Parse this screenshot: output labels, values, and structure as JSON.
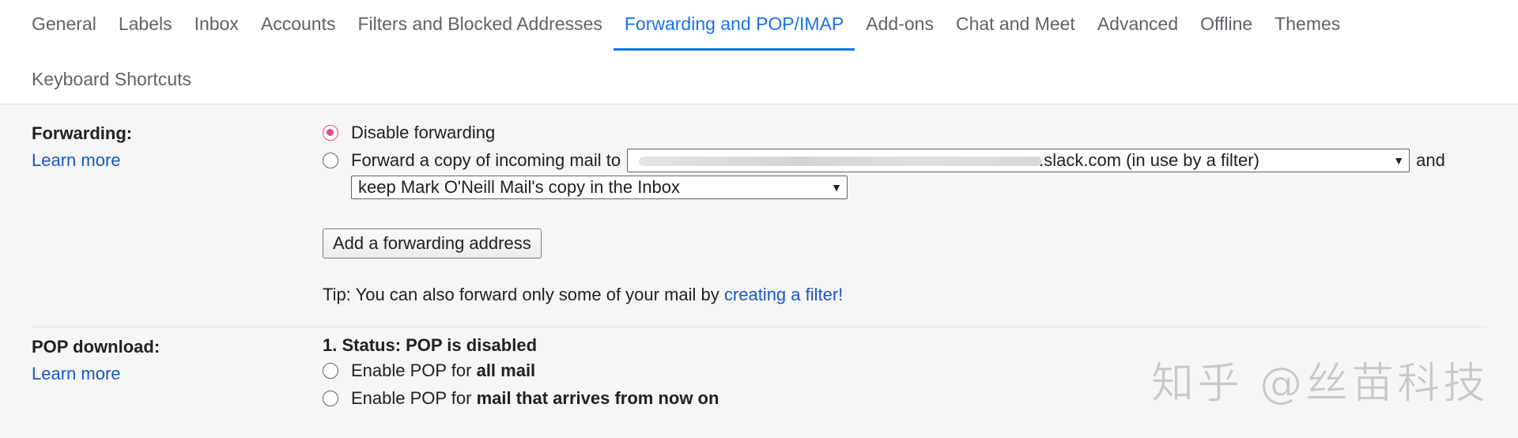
{
  "tabs": {
    "row1": [
      {
        "label": "General",
        "active": false
      },
      {
        "label": "Labels",
        "active": false
      },
      {
        "label": "Inbox",
        "active": false
      },
      {
        "label": "Accounts",
        "active": false
      },
      {
        "label": "Filters and Blocked Addresses",
        "active": false
      },
      {
        "label": "Forwarding and POP/IMAP",
        "active": true
      },
      {
        "label": "Add-ons",
        "active": false
      },
      {
        "label": "Chat and Meet",
        "active": false
      },
      {
        "label": "Advanced",
        "active": false
      },
      {
        "label": "Offline",
        "active": false
      },
      {
        "label": "Themes",
        "active": false
      }
    ],
    "row2": [
      {
        "label": "Keyboard Shortcuts",
        "active": false
      }
    ]
  },
  "forwarding": {
    "label": "Forwarding:",
    "learn_more": "Learn more",
    "disable_option": "Disable forwarding",
    "forward_option": "Forward a copy of incoming mail to",
    "forward_address_visible": ".slack.com (in use by a filter)",
    "and_text": "and",
    "keep_option": "keep Mark O'Neill Mail's copy in the Inbox",
    "add_button": "Add a forwarding address",
    "tip_prefix": "Tip: You can also forward only some of your mail by ",
    "tip_link": "creating a filter!"
  },
  "pop": {
    "label": "POP download:",
    "learn_more": "Learn more",
    "status": "1. Status: POP is disabled",
    "enable_prefix": "Enable POP for ",
    "all_mail": "all mail",
    "enable_now_prefix": "Enable POP for ",
    "from_now_on": "mail that arrives from now on"
  },
  "watermark": "知乎 @丝苗科技",
  "colors": {
    "accent": "#1a73e8",
    "link": "#1a57c7",
    "radio_checked": "#e8478a"
  }
}
